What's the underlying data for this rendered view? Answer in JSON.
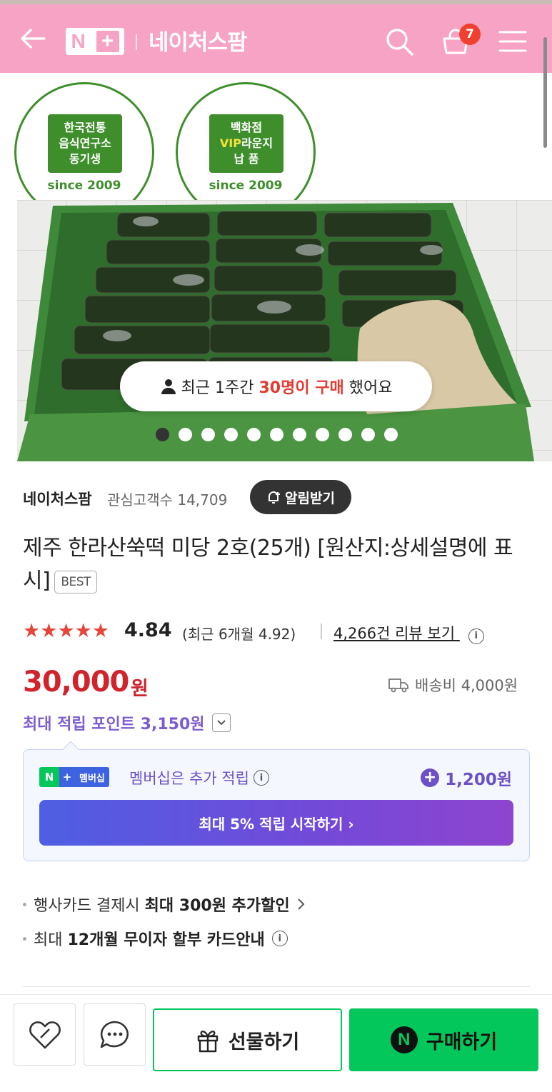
{
  "header": {
    "logo_n": "N",
    "logo_plus": "+",
    "title": "네이처스팜",
    "cart_count": "7",
    "icons": [
      "back-arrow-icon",
      "search-icon",
      "cart-icon",
      "menu-icon"
    ]
  },
  "stamps": [
    {
      "lines": [
        "한국전통",
        "음식연구소",
        "동기생"
      ],
      "since": "since 2009"
    },
    {
      "line1": "백화점",
      "vip": "VIP",
      "line2_rest": "라운지",
      "line3": "납 품",
      "since": "since 2009"
    }
  ],
  "gallery": {
    "buyer_prefix": "최근 1주간 ",
    "buyer_highlight": "30명이 구매",
    "buyer_suffix": " 했어요",
    "dot_count": 11,
    "active_dot": 0
  },
  "seller": {
    "name": "네이처스팜",
    "fans": "관심고객수 14,709",
    "alarm_label": "알림받기"
  },
  "product": {
    "title": "제주 한라산쑥떡 미당 2호(25개) [원산지:상세설명에 표시]",
    "badge": "BEST",
    "rating": "4.84",
    "recent_rating": "(최근 6개월 4.92)",
    "reviews": "4,266건 리뷰 보기",
    "price": "30,000",
    "currency": "원",
    "shipping": "배송비 4,000원",
    "points": "최대 적립 포인트 3,150원"
  },
  "membership": {
    "badge_n": "N",
    "badge_plus": "+",
    "badge_text": "멤버십",
    "text": "멤버십은 추가 적립",
    "points": "1,200원",
    "start_button": "최대 5% 적립 시작하기 ›"
  },
  "benefits": {
    "card_prefix": "행사카드 결제시 ",
    "card_bold": "최대 300원 추가할인",
    "install_prefix": "최대 ",
    "install_bold": "12개월 무이자 할부 카드안내"
  },
  "bottom_bar": {
    "gift_label": "선물하기",
    "buy_label": "구매하기",
    "buy_icon_letter": "N"
  },
  "colors": {
    "header_pink": "#f7a3c6",
    "price_red": "#d0232c",
    "naver_green": "#03c75a",
    "points_purple": "#7c5ccf",
    "stamp_green": "#3e8e2b"
  }
}
